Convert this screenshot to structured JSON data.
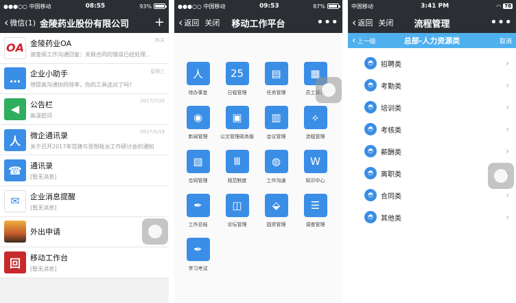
{
  "phone1": {
    "status": {
      "carrier": "●●●○○ 中国移动",
      "time": "08:55",
      "battery": "93%"
    },
    "nav": {
      "back": "微信(1)",
      "title": "金陵药业股份有限公司",
      "action": "+"
    },
    "rows": [
      {
        "name": "金陵药业OA",
        "msg": "请查阅工作沟通回复：关联合同的错误已经处理...",
        "time": "昨天",
        "avatar_text": "OA",
        "color": "#ffffff"
      },
      {
        "name": "企业小助手",
        "msg": "想提高沟通协同效率，你的工具选对了吗?",
        "time": "星期三",
        "avatar_text": "…",
        "color": "#3a8ee6"
      },
      {
        "name": "公告栏",
        "msg": "高温慰问",
        "time": "2017/7/20",
        "avatar_text": "◀",
        "color": "#2fae5f"
      },
      {
        "name": "微企通讯录",
        "msg": "关于召开2017年党建与思想政治工作研讨会的通知",
        "time": "2017/5/19",
        "avatar_text": "人",
        "color": "#3a8ee6"
      },
      {
        "name": "通讯录",
        "msg": "[暂无消息]",
        "time": "",
        "avatar_text": "☎",
        "color": "#3a8ee6"
      },
      {
        "name": "企业消息提醒",
        "msg": "[暂无消息]",
        "time": "",
        "avatar_text": "✉",
        "color": "#ffffff"
      },
      {
        "name": "外出申请",
        "msg": "",
        "time": "",
        "avatar_text": "",
        "color": "#c45a2a"
      },
      {
        "name": "移动工作台",
        "msg": "[暂无消息]",
        "time": "",
        "avatar_text": "回",
        "color": "#c72a2a"
      }
    ]
  },
  "phone2": {
    "status": {
      "carrier": "●●●○○ 中国移动",
      "time": "09:53",
      "battery": "87%"
    },
    "nav": {
      "back": "返回",
      "close": "关闭",
      "title": "移动工作平台",
      "more": "•••"
    },
    "apps": [
      {
        "label": "待办事宜",
        "icon": "人"
      },
      {
        "label": "日程管理",
        "icon": "25"
      },
      {
        "label": "任务管理",
        "icon": "▤"
      },
      {
        "label": "员工黄页",
        "icon": "▦"
      },
      {
        "label": "新闻管理",
        "icon": "◉"
      },
      {
        "label": "公文管理政务版",
        "icon": "▣"
      },
      {
        "label": "会议管理",
        "icon": "▥"
      },
      {
        "label": "流程管理",
        "icon": "⟡"
      },
      {
        "label": "合同管理",
        "icon": "▧"
      },
      {
        "label": "规范制度",
        "icon": "Ⅲ"
      },
      {
        "label": "工作沟通",
        "icon": "◍"
      },
      {
        "label": "知识中心",
        "icon": "W"
      },
      {
        "label": "工作总结",
        "icon": "✒"
      },
      {
        "label": "论坛管理",
        "icon": "◫"
      },
      {
        "label": "固资管理",
        "icon": "⬙"
      },
      {
        "label": "调查管理",
        "icon": "☰"
      },
      {
        "label": "学习考试",
        "icon": "✒"
      }
    ]
  },
  "phone3": {
    "status": {
      "carrier": "中国移动",
      "time": "3:41 PM",
      "battery": "78"
    },
    "nav": {
      "back": "返回",
      "close": "关闭",
      "title": "流程管理",
      "more": "•••"
    },
    "subbar": {
      "up": "上一级",
      "title": "总部-人力资源类",
      "cancel": "取消"
    },
    "categories": [
      "招聘类",
      "考勤类",
      "培训类",
      "考核类",
      "薪酬类",
      "离职类",
      "合同类",
      "其他类"
    ]
  },
  "colors": {
    "accent": "#3a8ee6",
    "dark_nav": "#2b2e33",
    "sub_bar": "#4fb0ef"
  }
}
